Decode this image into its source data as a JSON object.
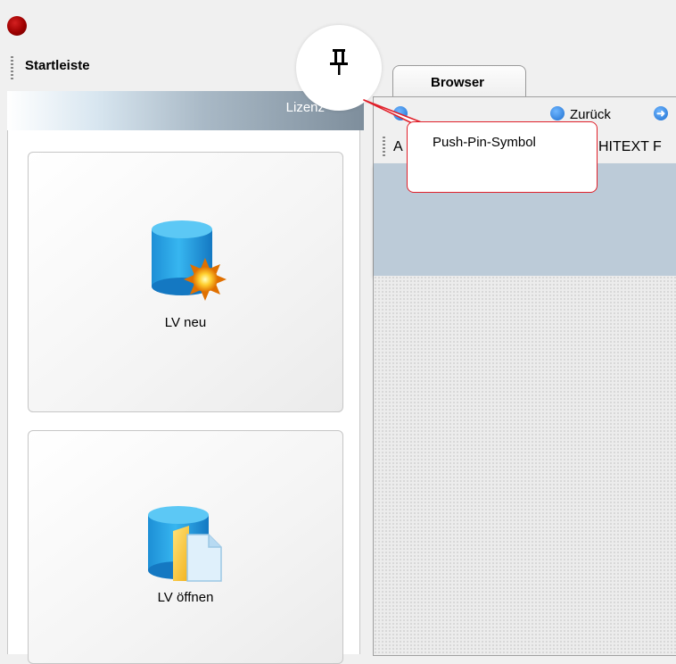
{
  "window": {
    "app_icon": "red-dot-app-icon"
  },
  "left_panel": {
    "title": "Startleiste",
    "banner_text": "Lizenz",
    "tiles": [
      {
        "label": "LV neu",
        "icon": "database-new-icon"
      },
      {
        "label": "LV öffnen",
        "icon": "database-open-icon"
      }
    ]
  },
  "pin": {
    "icon": "push-pin-icon"
  },
  "callout": {
    "text": "Push-Pin-Symbol",
    "border_color": "#e0202a"
  },
  "browser": {
    "tab_label": "Browser",
    "back_label": "Zurück",
    "address_label": "A",
    "address_value": "HITEXT F"
  },
  "colors": {
    "banner_gradient_end": "#7e8e9c",
    "band": "#bccbd8"
  }
}
